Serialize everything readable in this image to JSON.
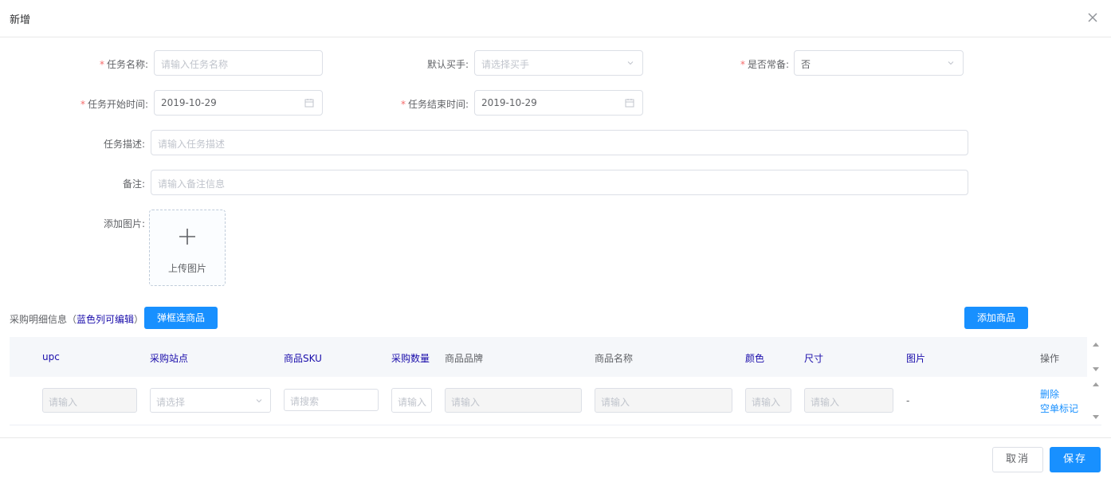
{
  "dialog": {
    "title": "新增"
  },
  "form": {
    "task_name": {
      "label": "任务名称:",
      "placeholder": "请输入任务名称"
    },
    "default_buyer": {
      "label": "默认买手:",
      "placeholder": "请选择买手"
    },
    "is_regular": {
      "label": "是否常备:",
      "value": "否"
    },
    "start_time": {
      "label": "任务开始时间:",
      "value": "2019-10-29"
    },
    "end_time": {
      "label": "任务结束时间:",
      "value": "2019-10-29"
    },
    "description": {
      "label": "任务描述:",
      "placeholder": "请输入任务描述"
    },
    "remark": {
      "label": "备注:",
      "placeholder": "请输入备注信息"
    },
    "image": {
      "label": "添加图片:",
      "upload_text": "上传图片"
    },
    "required_mark": "*"
  },
  "detail": {
    "title_prefix": "采购明细信息（",
    "title_blue": "蓝色列可编辑",
    "title_suffix": "）",
    "popup_select_button": "弹框选商品",
    "add_product_button": "添加商品"
  },
  "table": {
    "columns": [
      "upc",
      "采购站点",
      "商品SKU",
      "采购数量",
      "商品品牌",
      "商品名称",
      "颜色",
      "尺寸",
      "图片",
      "操作"
    ],
    "row": {
      "upc_placeholder": "请输入",
      "site_placeholder": "请选择",
      "sku_placeholder": "请搜索",
      "qty_placeholder": "请输入",
      "brand_placeholder": "请输入",
      "name_placeholder": "请输入",
      "color_placeholder": "请输入",
      "size_placeholder": "请输入",
      "image_value": "-",
      "delete_link": "删除",
      "mark_link": "空单标记"
    }
  },
  "footer": {
    "cancel": "取消",
    "save": "保存"
  },
  "colors": {
    "primary": "#1890ff",
    "required": "#f56c6c",
    "editable_header": "#1a0dab"
  }
}
